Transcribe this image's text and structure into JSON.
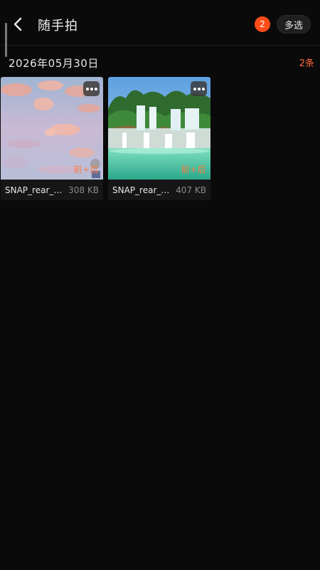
{
  "header": {
    "title": "随手拍",
    "count_badge": "2",
    "multi_select_label": "多选"
  },
  "section": {
    "date": "2026年05月30日",
    "count": "2条"
  },
  "photos": [
    {
      "filename": "SNAP_rear_2…",
      "size": "308 KB",
      "tag": "前+后",
      "icon": "sky-clouds-thumbnail"
    },
    {
      "filename": "SNAP_rear_2…",
      "size": "407 KB",
      "tag": "前+后",
      "icon": "waterfall-thumbnail"
    }
  ],
  "colors": {
    "background": "#0a0a0a",
    "accent": "#ff4d1a",
    "tag": "#ff7a3d"
  }
}
